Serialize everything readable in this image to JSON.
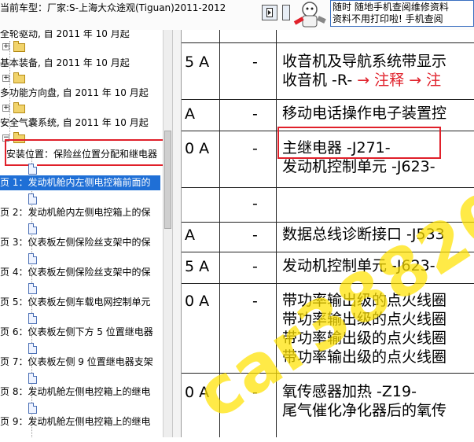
{
  "header": {
    "car_title": "当前车型：厂家:S-上海大众途观(Tiguan)2011-2012",
    "ad_line1": "随时 随地手机查阅维修资料",
    "ad_line2": "资料不用打印啦! 手机查阅"
  },
  "tree": {
    "items": [
      {
        "label": "全轮驱动, 自 2011 年 10 月起",
        "type": "folder-cut"
      },
      {
        "label": "基本装备, 自 2011 年 10 月起",
        "type": "folder"
      },
      {
        "label": "多功能方向盘, 自 2011 年 10 月起",
        "type": "folder"
      },
      {
        "label": "安全气囊系统, 自 2011 年 10 月起",
        "type": "folder"
      },
      {
        "label": "安装位置：保险丝位置分配和继电器",
        "type": "folder-open"
      },
      {
        "label": "页 1：发动机舱内左侧电控箱前面的",
        "type": "doc",
        "selected": true
      },
      {
        "label": "页 2：发动机舱内左侧电控箱上的保",
        "type": "doc"
      },
      {
        "label": "页 3：仪表板左侧保险丝支架中的保",
        "type": "doc"
      },
      {
        "label": "页 4：仪表板左侧保险丝支架中的保",
        "type": "doc"
      },
      {
        "label": "页 5：仪表板左侧车载电网控制单元",
        "type": "doc"
      },
      {
        "label": "页 6：仪表板左侧下方 5 位置继电器",
        "type": "doc"
      },
      {
        "label": "页 7：仪表板左侧 9 位置继电器支架",
        "type": "doc"
      },
      {
        "label": "页 8：发动机舱左侧电控箱上的继电",
        "type": "doc"
      },
      {
        "label": "页 9：发动机舱左侧电控箱上的继电",
        "type": "doc"
      }
    ]
  },
  "table": {
    "rows": [
      {
        "amp": "",
        "dash": "",
        "lines": [
          {
            "text": "",
            "note": ""
          }
        ]
      },
      {
        "amp": "5 A",
        "dash": "-",
        "lines": [
          {
            "text": "收音机及导航系统带显示",
            "note": ""
          },
          {
            "text": "收音机 -R-",
            "note": " → 注释 → 注"
          }
        ]
      },
      {
        "amp": "A",
        "dash": "-",
        "lines": [
          {
            "text": "移动电话操作电子装置控",
            "note": ""
          }
        ]
      },
      {
        "amp": "0 A",
        "dash": "-",
        "lines": [
          {
            "text": "主继电器 -J271-",
            "note": ""
          },
          {
            "text": "发动机控制单元 -J623-",
            "note": ""
          }
        ]
      },
      {
        "amp": "",
        "dash": "-",
        "lines": [
          {
            "text": "",
            "note": ""
          }
        ]
      },
      {
        "amp": "A",
        "dash": "-",
        "lines": [
          {
            "text": "数据总线诊断接口 -J533",
            "note": ""
          }
        ]
      },
      {
        "amp": "5 A",
        "dash": "-",
        "lines": [
          {
            "text": "发动机控制单元 -J623-",
            "note": ""
          }
        ]
      },
      {
        "amp": "0 A",
        "dash": "-",
        "lines": [
          {
            "text": "带功率输出级的点火线圈",
            "note": ""
          },
          {
            "text": "带功率输出级的点火线圈",
            "note": ""
          },
          {
            "text": "带功率输出级的点火线圈",
            "note": ""
          },
          {
            "text": "带功率输出级的点火线圈",
            "note": ""
          }
        ]
      },
      {
        "amp": "0 A",
        "dash": "-",
        "lines": [
          {
            "text": "氧传感器加热 -Z19-",
            "note": ""
          },
          {
            "text": "尾气催化净化器后的氧传",
            "note": ""
          }
        ]
      }
    ],
    "top_cut_text": "...系..."
  },
  "watermark": {
    "text": "car388201"
  },
  "colors": {
    "selection": "#1f6fd6",
    "highlight_box": "#e0202a",
    "watermark": "#ffe200",
    "note_red": "#e0202a"
  }
}
